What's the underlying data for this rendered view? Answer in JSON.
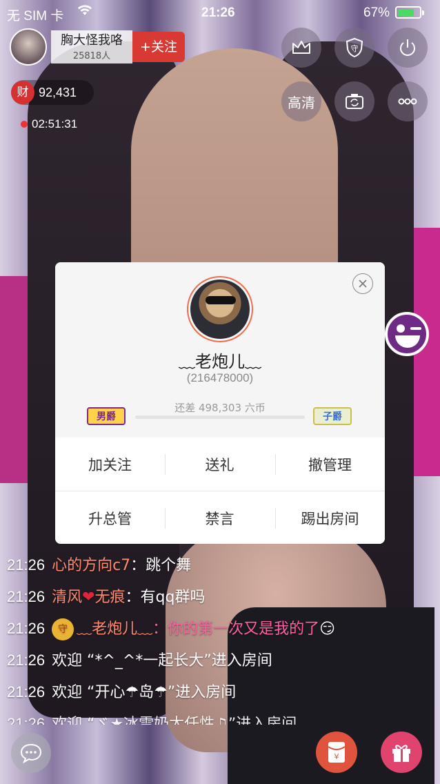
{
  "status": {
    "carrier": "无 SIM 卡",
    "time": "21:26",
    "battery": "67%",
    "battery_level": 0.67
  },
  "host": {
    "name": "胸大怪我咯",
    "fans": "25818人",
    "follow_label": "+关注"
  },
  "wealth": {
    "icon_text": "财",
    "value": "92,431"
  },
  "live_timer": "02:51:31",
  "right_controls": {
    "quality_label": "高清"
  },
  "icons": [
    "crown-icon",
    "guard-icon",
    "power-icon",
    "camera-switch-icon",
    "more-icon",
    "emoji-icon",
    "chat-icon",
    "red-packet-icon",
    "gift-icon",
    "close-icon"
  ],
  "profile": {
    "name": "﹏老炮儿﹏",
    "id": "(216478000)",
    "progress_text": "还差 498,303 六币",
    "rank_current": "男爵",
    "rank_next": "子爵",
    "actions": [
      "加关注",
      "送礼",
      "撤管理",
      "升总管",
      "禁言",
      "踢出房间"
    ]
  },
  "chat": [
    {
      "time": "21:26",
      "user": "心的方向c7",
      "sep": "：",
      "msg": "跳个舞"
    },
    {
      "time": "21:26",
      "user": "清风",
      "user2": "无痕",
      "sep": "：",
      "msg": "有qq群吗"
    },
    {
      "time": "21:26",
      "badge": "守",
      "user": "﹏老炮儿﹏",
      "sep": "：",
      "msg": "你的第一次又是我的了"
    },
    {
      "time": "21:26",
      "msg": "欢迎 “*^_^*一起长大”进入房间"
    },
    {
      "time": "21:26",
      "msg": "欢迎 “开心☂岛☂”进入房间"
    },
    {
      "time": "21:26",
      "msg": "欢迎 “ゞ★冰雪奶太任性♫”进入房间"
    }
  ],
  "colors": {
    "accent_red": "#d83a33",
    "username": "#ff8a6d",
    "highlight_msg": "#ff5fa1",
    "gift_button": "#e0436e"
  }
}
